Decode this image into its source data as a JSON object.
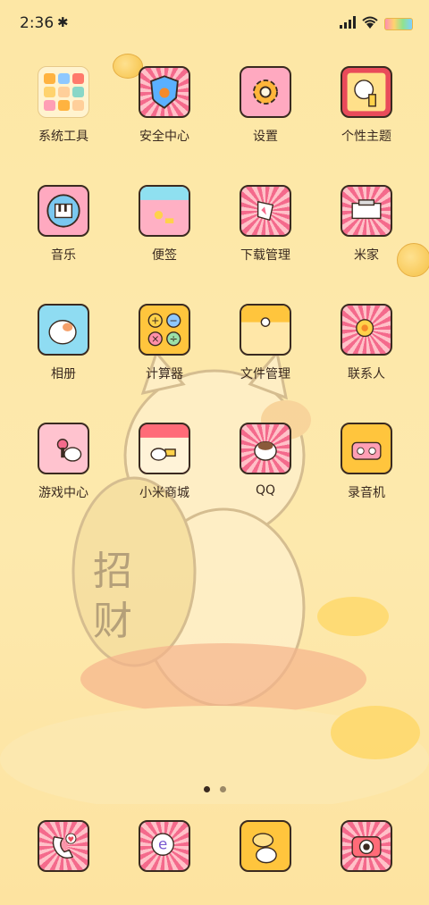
{
  "status": {
    "time": "2:36"
  },
  "apps": [
    {
      "label": "系统工具",
      "icon": "folder-icon"
    },
    {
      "label": "安全中心",
      "icon": "shield-paw-icon"
    },
    {
      "label": "设置",
      "icon": "gear-icon"
    },
    {
      "label": "个性主题",
      "icon": "cat-theme-icon"
    },
    {
      "label": "音乐",
      "icon": "piano-icon"
    },
    {
      "label": "便签",
      "icon": "note-icon"
    },
    {
      "label": "下载管理",
      "icon": "download-icon"
    },
    {
      "label": "米家",
      "icon": "home-icon"
    },
    {
      "label": "相册",
      "icon": "gallery-icon"
    },
    {
      "label": "计算器",
      "icon": "calculator-icon"
    },
    {
      "label": "文件管理",
      "icon": "folder-file-icon"
    },
    {
      "label": "联系人",
      "icon": "contacts-icon"
    },
    {
      "label": "游戏中心",
      "icon": "game-icon"
    },
    {
      "label": "小米商城",
      "icon": "mall-icon"
    },
    {
      "label": "QQ",
      "icon": "qq-icon"
    },
    {
      "label": "录音机",
      "icon": "recorder-icon"
    }
  ],
  "dock": [
    {
      "icon": "phone-icon"
    },
    {
      "icon": "browser-icon"
    },
    {
      "icon": "messages-icon"
    },
    {
      "icon": "camera-icon"
    }
  ],
  "wallpaper": {
    "sign_text": "招财"
  },
  "colors": {
    "background": "#fde9ad",
    "accent_pink": "#f46a8c",
    "accent_yellow": "#ffc53d",
    "outline": "#3a2a20"
  }
}
